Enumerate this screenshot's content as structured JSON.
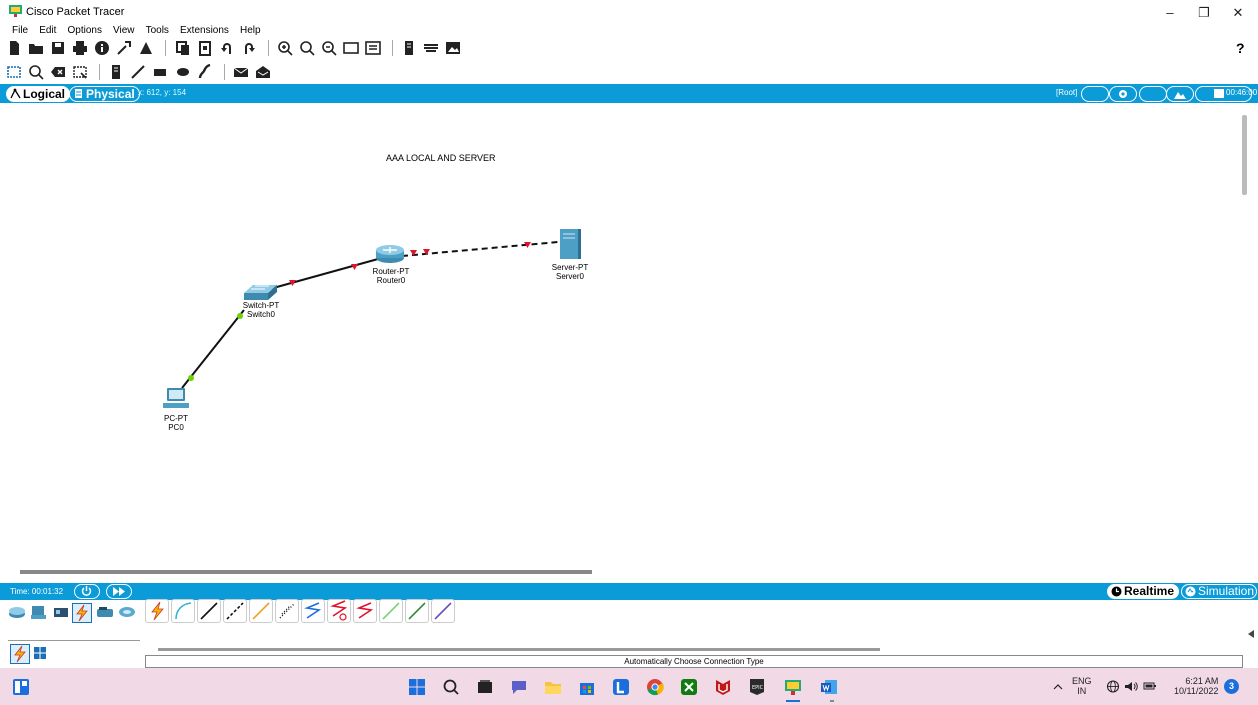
{
  "window": {
    "title": "Cisco Packet Tracer",
    "minimize": "–",
    "restore": "❐",
    "close": "✕"
  },
  "menu": [
    "File",
    "Edit",
    "Options",
    "View",
    "Tools",
    "Extensions",
    "Help"
  ],
  "toolbar": {
    "help": "?"
  },
  "modebar": {
    "logical": "Logical",
    "physical": "Physical",
    "coords": "x: 612, y: 154",
    "root": "[Root]",
    "clock": "00:46:00"
  },
  "workspace": {
    "banner": "AAA LOCAL AND SERVER",
    "devices": {
      "pc": {
        "type": "PC-PT",
        "name": "PC0"
      },
      "switch": {
        "type": "Switch-PT",
        "name": "Switch0"
      },
      "router": {
        "type": "Router-PT",
        "name": "Router0"
      },
      "server": {
        "type": "Server-PT",
        "name": "Server0"
      }
    }
  },
  "timebar": {
    "time": "Time: 00:01:32",
    "realtime": "Realtime",
    "simulation": "Simulation"
  },
  "palette": {
    "status": "Automatically Choose Connection Type"
  },
  "taskbar": {
    "lang1": "ENG",
    "lang2": "IN",
    "time": "6:21 AM",
    "date": "10/11/2022",
    "notifications": "3"
  },
  "colors": {
    "accent": "#0a9bd8",
    "taskbar": "#f2d9e6",
    "link_up": "#6dd400",
    "link_down": "#e0142b"
  }
}
